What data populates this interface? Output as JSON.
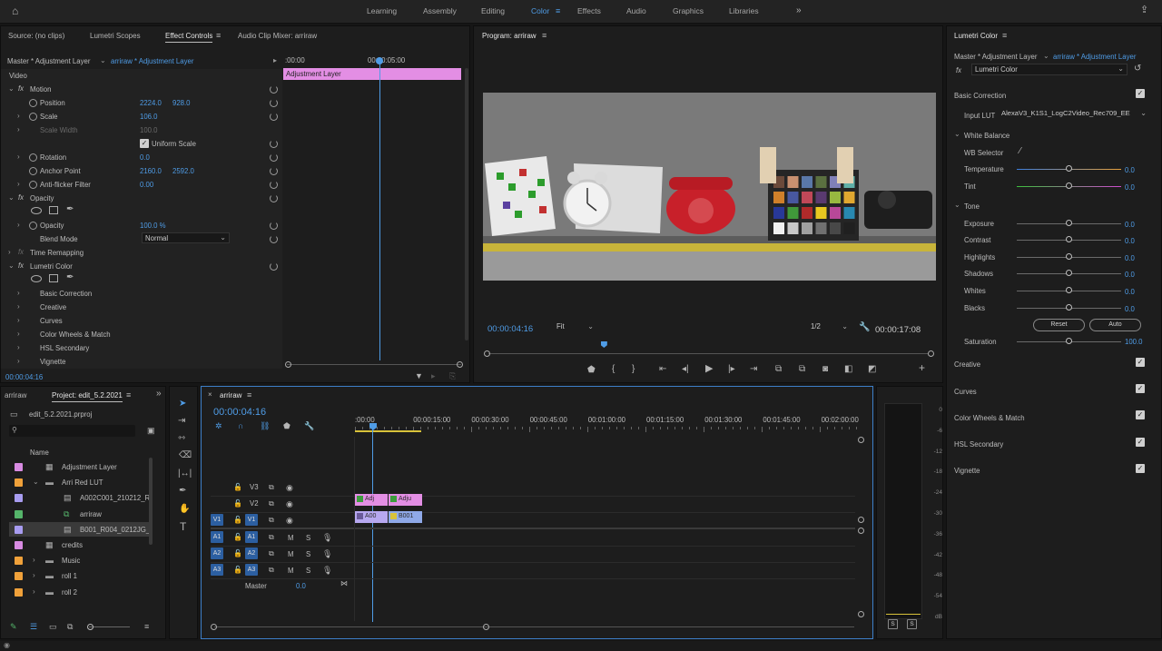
{
  "workspaces": [
    "Learning",
    "Assembly",
    "Editing",
    "Color",
    "Effects",
    "Audio",
    "Graphics",
    "Libraries"
  ],
  "active_workspace": "Color",
  "source_panel": {
    "tabs": [
      "Source: (no clips)",
      "Lumetri Scopes",
      "Effect Controls",
      "Audio Clip Mixer: arriraw"
    ],
    "master_label": "Master * Adjustment Layer",
    "clip_label": "arriraw * Adjustment Layer",
    "ruler_start": ":00:00",
    "ruler_time": "00:00:05:00",
    "clip_bar": "Adjustment Layer",
    "video_label": "Video",
    "motion": "Motion",
    "position": "Position",
    "position_x": "2224.0",
    "position_y": "928.0",
    "scale": "Scale",
    "scale_val": "106.0",
    "scale_width": "Scale Width",
    "scale_width_val": "100.0",
    "uniform_scale": "Uniform Scale",
    "rotation": "Rotation",
    "rotation_val": "0.0",
    "anchor": "Anchor Point",
    "anchor_x": "2160.0",
    "anchor_y": "2592.0",
    "antiflicker": "Anti-flicker Filter",
    "antiflicker_val": "0.00",
    "opacity_group": "Opacity",
    "opacity": "Opacity",
    "opacity_val": "100.0 %",
    "blend": "Blend Mode",
    "blend_val": "Normal",
    "time_remap": "Time Remapping",
    "lumetri": "Lumetri Color",
    "lumetri_items": [
      "Basic Correction",
      "Creative",
      "Curves",
      "Color Wheels & Match",
      "HSL Secondary",
      "Vignette"
    ],
    "timecode": "00:00:04:16"
  },
  "program": {
    "title": "Program: arriraw",
    "timecode": "00:00:04:16",
    "fit": "Fit",
    "resolution": "1/2",
    "duration": "00:00:17:08",
    "playhead_fraction": 0.26
  },
  "lumetri_panel": {
    "title": "Lumetri Color",
    "master_label": "Master * Adjustment Layer",
    "clip_label": "arriraw * Adjustment Layer",
    "effect": "Lumetri Color",
    "basic": "Basic Correction",
    "input_lut_label": "Input LUT",
    "input_lut": "AlexaV3_K1S1_LogC2Video_Rec709_EE",
    "white_balance": "White Balance",
    "wb_selector": "WB Selector",
    "sliders_wb": [
      {
        "label": "Temperature",
        "value": "0.0",
        "pos": 0.5
      },
      {
        "label": "Tint",
        "value": "0.0",
        "pos": 0.5
      }
    ],
    "tone": "Tone",
    "sliders_tone": [
      {
        "label": "Exposure",
        "value": "0.0",
        "pos": 0.5
      },
      {
        "label": "Contrast",
        "value": "0.0",
        "pos": 0.5
      },
      {
        "label": "Highlights",
        "value": "0.0",
        "pos": 0.5
      },
      {
        "label": "Shadows",
        "value": "0.0",
        "pos": 0.5
      },
      {
        "label": "Whites",
        "value": "0.0",
        "pos": 0.5
      },
      {
        "label": "Blacks",
        "value": "0.0",
        "pos": 0.5
      }
    ],
    "reset": "Reset",
    "auto": "Auto",
    "saturation": "Saturation",
    "saturation_val": "100.0",
    "sections": [
      "Creative",
      "Curves",
      "Color Wheels & Match",
      "HSL Secondary",
      "Vignette"
    ]
  },
  "project": {
    "tabs": [
      "arriraw",
      "Project: edit_5.2.2021"
    ],
    "file": "edit_5.2.2021.prproj",
    "col_name": "Name",
    "items": [
      {
        "name": "Adjustment Layer",
        "color": "#d88be2",
        "indent": 0,
        "icon": "adjustment-icon"
      },
      {
        "name": "Arri Red LUT",
        "color": "#f0a13a",
        "indent": 0,
        "icon": "folder-icon",
        "expanded": true
      },
      {
        "name": "A002C001_210212_R2",
        "color": "#a89cf0",
        "indent": 2,
        "icon": "clip-icon"
      },
      {
        "name": "arriraw",
        "color": "#55b46a",
        "indent": 2,
        "icon": "sequence-icon"
      },
      {
        "name": "B001_R004_0212JG_0",
        "color": "#a89cf0",
        "indent": 2,
        "icon": "clip-icon",
        "selected": true
      },
      {
        "name": "credits",
        "color": "#d88be2",
        "indent": 0,
        "icon": "adjustment-icon"
      },
      {
        "name": "Music",
        "color": "#f0a13a",
        "indent": 0,
        "icon": "folder-icon"
      },
      {
        "name": "roll 1",
        "color": "#f0a13a",
        "indent": 0,
        "icon": "folder-icon"
      },
      {
        "name": "roll 2",
        "color": "#f0a13a",
        "indent": 0,
        "icon": "folder-icon"
      }
    ]
  },
  "timeline": {
    "title": "arriraw",
    "timecode": "00:00:04:16",
    "ruler": [
      ":00:00",
      "00:00:15:00",
      "00:00:30:00",
      "00:00:45:00",
      "00:01:00:00",
      "00:01:15:00",
      "00:01:30:00",
      "00:01:45:00",
      "00:02:00:00"
    ],
    "video_tracks": [
      "V3",
      "V2",
      "V1"
    ],
    "audio_tracks": [
      "A1",
      "A2",
      "A3"
    ],
    "master": "Master",
    "master_val": "0.0",
    "clips_v2": [
      "Adj",
      "Adju"
    ],
    "clips_v1": [
      "A00",
      "B001"
    ],
    "m": "M",
    "s": "S"
  },
  "meter": {
    "labels": [
      "0",
      "-6",
      "-12",
      "-18",
      "-24",
      "-30",
      "-36",
      "-42",
      "-48",
      "-54",
      "dB"
    ],
    "s": "S"
  }
}
